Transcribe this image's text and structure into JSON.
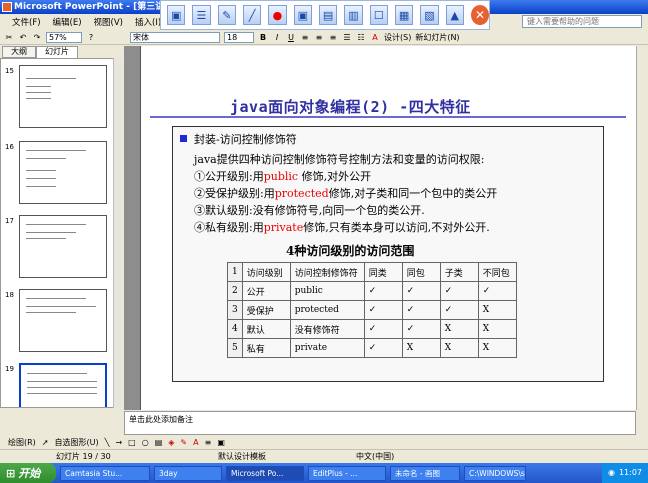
{
  "window": {
    "title": "Microsoft PowerPoint - [第三讲"
  },
  "annotation_toolbar": {
    "tools": [
      "▣",
      "☰",
      "✎",
      "╱",
      "●",
      "▣",
      "▤",
      "▥",
      "☐",
      "▦",
      "▧",
      "▲"
    ],
    "close": "✕"
  },
  "menu": [
    "文件(F)",
    "编辑(E)",
    "视图(V)",
    "插入(I)"
  ],
  "help_box": {
    "placeholder": "键入需要帮助的问题"
  },
  "toolbar": {
    "zoom": "57%",
    "font": "宋体",
    "size": "18",
    "bold": "B",
    "italic": "I",
    "underline": "U",
    "design": "设计(S)",
    "new_slide": "新幻灯片(N)"
  },
  "panel_tabs": [
    "大纲",
    "幻灯片"
  ],
  "thumbnails": [
    {
      "num": "15"
    },
    {
      "num": "16"
    },
    {
      "num": "17"
    },
    {
      "num": "18"
    },
    {
      "num": "19"
    }
  ],
  "slide": {
    "title": "java面向对象编程(2)   -四大特征",
    "bullet": "封装-访问控制修饰符",
    "lines": [
      {
        "a": "java提供四种访问控制修饰符号控制方法和变量的访问权限:",
        "b": "",
        "c": ""
      },
      {
        "a": "①公开级别:用",
        "b": "public",
        "c": " 修饰,对外公开"
      },
      {
        "a": "②受保护级别:用",
        "b": "protected",
        "c": "修饰,对子类和同一个包中的类公开"
      },
      {
        "a": "③默认级别:没有修饰符号,向同一个包的类公开.",
        "b": "",
        "c": ""
      },
      {
        "a": "④私有级别:用",
        "b": "private",
        "c": "修饰,只有类本身可以访问,不对外公开."
      }
    ],
    "table_title": "4种访问级别的访问范围",
    "table": [
      [
        "1",
        "访问级别",
        "访问控制修饰符",
        "同类",
        "同包",
        "子类",
        "不同包"
      ],
      [
        "2",
        "公开",
        "public",
        "✓",
        "✓",
        "✓",
        "✓"
      ],
      [
        "3",
        "受保护",
        "protected",
        "✓",
        "✓",
        "✓",
        "X"
      ],
      [
        "4",
        "默认",
        "没有修饰符",
        "✓",
        "✓",
        "X",
        "X"
      ],
      [
        "5",
        "私有",
        "private",
        "✓",
        "X",
        "X",
        "X"
      ]
    ]
  },
  "notes": {
    "placeholder": "单击此处添加备注"
  },
  "drawbar": {
    "draw": "绘图(R)",
    "autoshape": "自选图形(U)"
  },
  "status": {
    "slide": "幻灯片 19 / 30",
    "template": "默认设计模板",
    "lang": "中文(中国)"
  },
  "taskbar": {
    "start": "开始",
    "tasks": [
      "Camtasia Stu...",
      "3day",
      "Microsoft Po...",
      "EditPlus - ...",
      "未命名 - 画图",
      "C:\\WINDOWS\\s..."
    ],
    "clock": "11:07"
  }
}
